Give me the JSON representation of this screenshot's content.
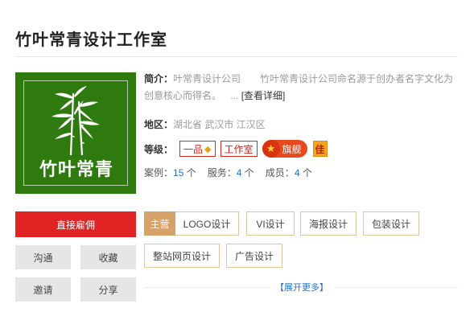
{
  "studio": {
    "name": "竹叶常青设计工作室",
    "logo_text": "竹叶常青"
  },
  "intro": {
    "label": "简介：",
    "name": "叶常青设计公司",
    "text": "竹叶常青设计公司命名源于创办者名字文化为创意核心而得名。",
    "ellipsis": "...",
    "detail_link": "[查看详细]"
  },
  "region": {
    "label": "地区：",
    "value": "湖北省 武汉市 江汉区"
  },
  "level": {
    "label": "等级：",
    "badges": {
      "rank": "一品",
      "type": "工作室",
      "flagship": "旗舰",
      "quality": "佳"
    },
    "colors": {
      "badge": "#d9251c",
      "flagship": "#e8481e",
      "quality": "#f4a61c"
    }
  },
  "stats": {
    "cases_label": "案例：",
    "cases": "15",
    "services_label": "服务：",
    "services": "4",
    "members_label": "成员：",
    "members": "4",
    "unit": "个"
  },
  "actions": {
    "hire": "直接雇佣",
    "chat": "沟通",
    "favorite": "收藏",
    "invite": "邀请",
    "share": "分享"
  },
  "services": {
    "main_label": "主营",
    "items": [
      "LOGO设计",
      "VI设计",
      "海报设计",
      "包装设计",
      "整站网页设计",
      "广告设计"
    ],
    "expand": "【展开更多】"
  },
  "colors": {
    "accent": "#e02424",
    "link": "#2a6fc9",
    "tag_main": "#d7a26a",
    "logo_bg": "#2f7a0f"
  }
}
